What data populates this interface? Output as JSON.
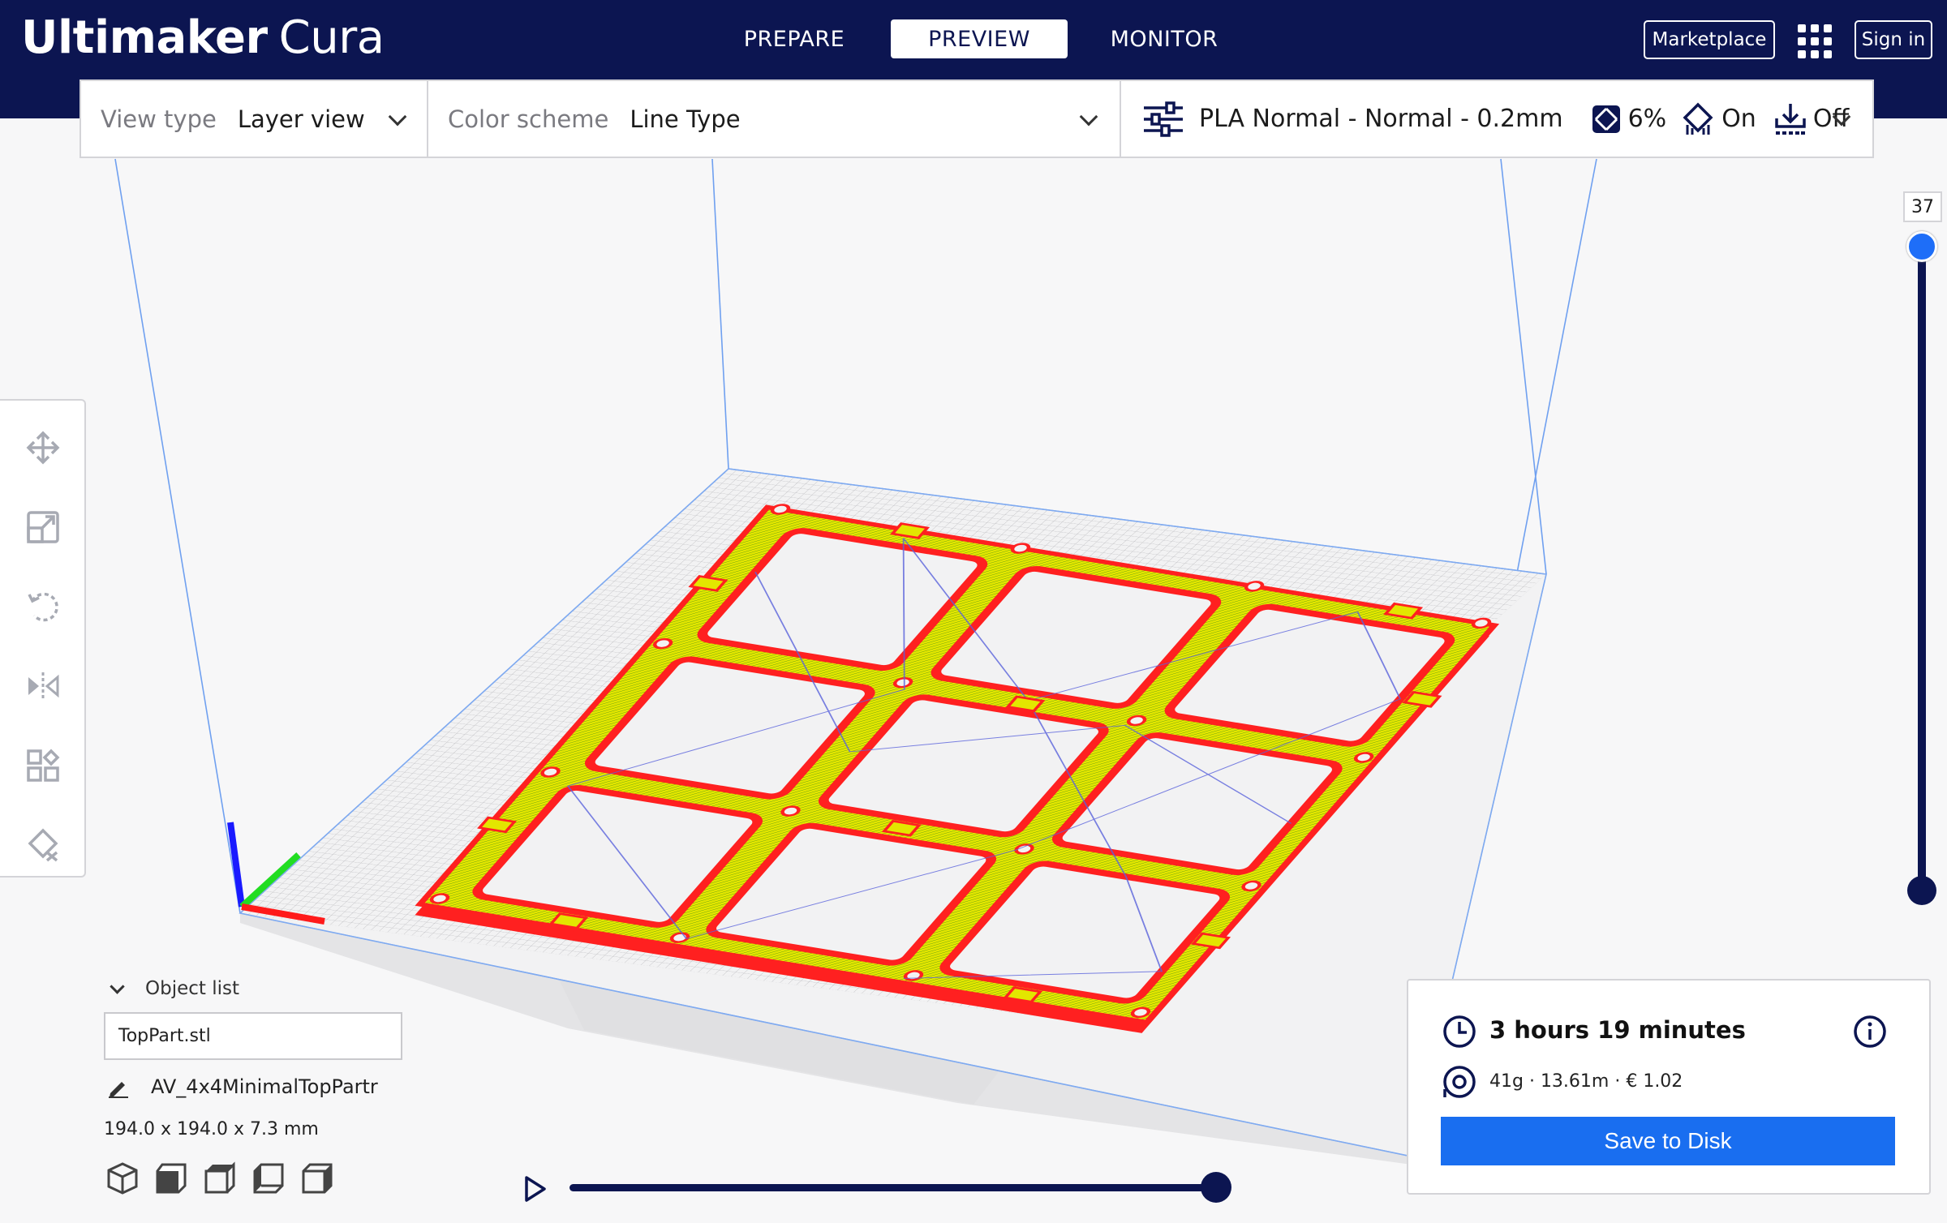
{
  "header": {
    "brand_bold": "Ultimaker",
    "brand_light": "Cura",
    "stages": [
      {
        "label": "PREPARE",
        "active": false
      },
      {
        "label": "PREVIEW",
        "active": true
      },
      {
        "label": "MONITOR",
        "active": false
      }
    ],
    "marketplace_label": "Marketplace",
    "signin_label": "Sign in",
    "apps_icon": "apps-grid-icon"
  },
  "view_settings": {
    "view_type_label": "View type",
    "view_type_value": "Layer view",
    "color_scheme_label": "Color scheme",
    "color_scheme_value": "Line Type"
  },
  "print_setup": {
    "profile": "PLA Normal - Normal - 0.2mm",
    "infill": "6%",
    "support": "On",
    "adhesion": "Off"
  },
  "tools": [
    {
      "icon": "move-icon"
    },
    {
      "icon": "scale-icon"
    },
    {
      "icon": "rotate-icon"
    },
    {
      "icon": "mirror-icon"
    },
    {
      "icon": "per-model-settings-icon"
    },
    {
      "icon": "support-blocker-icon"
    }
  ],
  "layer_slider": {
    "current_layer": "37",
    "track_color": "#0c1551",
    "handle_color": "#1e6ef8"
  },
  "object_list": {
    "toggle_label": "Object list",
    "selected_file": "TopPart.stl",
    "job_name": "AV_4x4MinimalTopPartr",
    "dimensions": "194.0 x 194.0 x 7.3 mm"
  },
  "view_orientations": [
    "3d-view-icon",
    "front-view-icon",
    "top-view-icon",
    "left-view-icon",
    "right-view-icon"
  ],
  "simulation": {
    "play_icon": "play-icon",
    "progress": 1.0
  },
  "print_info": {
    "time": "3 hours 19 minutes",
    "material": "41g · 13.61m · € 1.02",
    "save_label": "Save to Disk"
  },
  "colors": {
    "header_bg": "#0c1551",
    "accent": "#196ef0",
    "wall_red": "#ff1e1e",
    "infill_yellow": "#e6e600",
    "skin_green": "#3c9a1e",
    "travel_blue": "#5a63dc"
  }
}
